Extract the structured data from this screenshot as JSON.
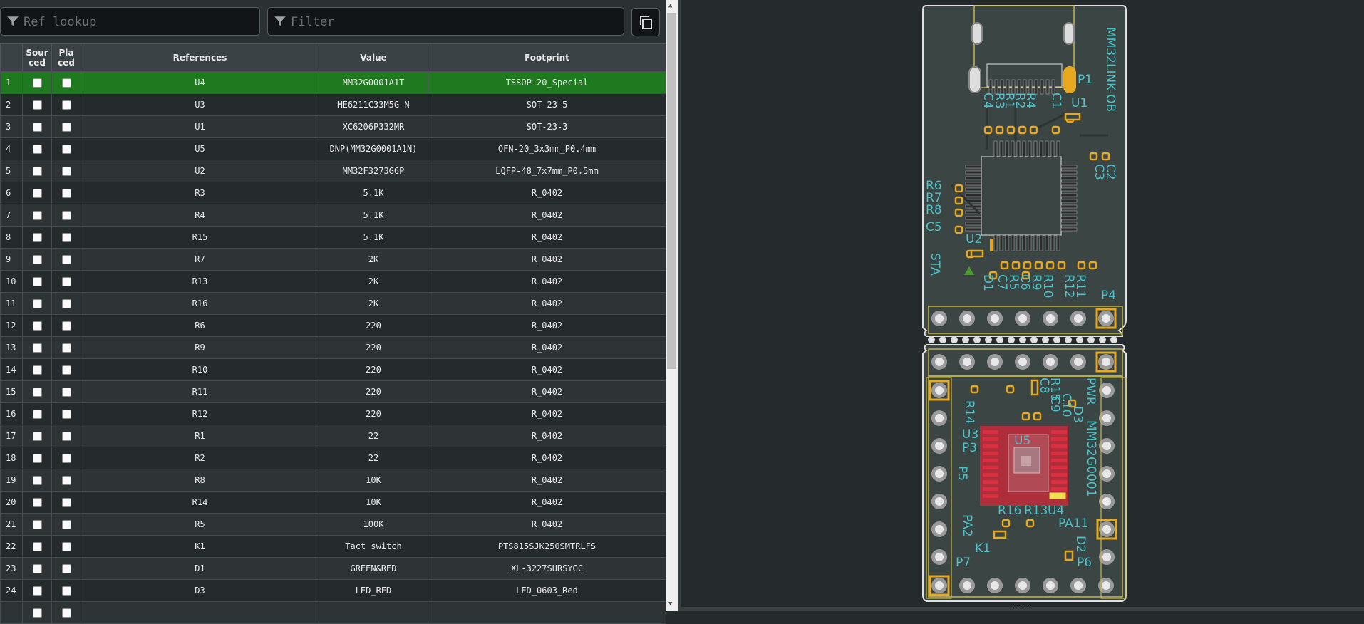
{
  "toolbar": {
    "ref_placeholder": "Ref lookup",
    "filter_placeholder": "Filter"
  },
  "table": {
    "headers": {
      "sourced": "Sourced",
      "placed": "Placed",
      "references": "References",
      "value": "Value",
      "footprint": "Footprint"
    },
    "rows": [
      {
        "n": "1",
        "ref": "U4",
        "value": "MM32G0001A1T",
        "footprint": "TSSOP-20_Special"
      },
      {
        "n": "2",
        "ref": "U3",
        "value": "ME6211C33M5G-N",
        "footprint": "SOT-23-5"
      },
      {
        "n": "3",
        "ref": "U1",
        "value": "XC6206P332MR",
        "footprint": "SOT-23-3"
      },
      {
        "n": "4",
        "ref": "U5",
        "value": "DNP(MM32G0001A1N)",
        "footprint": "QFN-20_3x3mm_P0.4mm"
      },
      {
        "n": "5",
        "ref": "U2",
        "value": "MM32F3273G6P",
        "footprint": "LQFP-48_7x7mm_P0.5mm"
      },
      {
        "n": "6",
        "ref": "R3",
        "value": "5.1K",
        "footprint": "R_0402"
      },
      {
        "n": "7",
        "ref": "R4",
        "value": "5.1K",
        "footprint": "R_0402"
      },
      {
        "n": "8",
        "ref": "R15",
        "value": "5.1K",
        "footprint": "R_0402"
      },
      {
        "n": "9",
        "ref": "R7",
        "value": "2K",
        "footprint": "R_0402"
      },
      {
        "n": "10",
        "ref": "R13",
        "value": "2K",
        "footprint": "R_0402"
      },
      {
        "n": "11",
        "ref": "R16",
        "value": "2K",
        "footprint": "R_0402"
      },
      {
        "n": "12",
        "ref": "R6",
        "value": "220",
        "footprint": "R_0402"
      },
      {
        "n": "13",
        "ref": "R9",
        "value": "220",
        "footprint": "R_0402"
      },
      {
        "n": "14",
        "ref": "R10",
        "value": "220",
        "footprint": "R_0402"
      },
      {
        "n": "15",
        "ref": "R11",
        "value": "220",
        "footprint": "R_0402"
      },
      {
        "n": "16",
        "ref": "R12",
        "value": "220",
        "footprint": "R_0402"
      },
      {
        "n": "17",
        "ref": "R1",
        "value": "22",
        "footprint": "R_0402"
      },
      {
        "n": "18",
        "ref": "R2",
        "value": "22",
        "footprint": "R_0402"
      },
      {
        "n": "19",
        "ref": "R8",
        "value": "10K",
        "footprint": "R_0402"
      },
      {
        "n": "20",
        "ref": "R14",
        "value": "10K",
        "footprint": "R_0402"
      },
      {
        "n": "21",
        "ref": "R5",
        "value": "100K",
        "footprint": "R_0402"
      },
      {
        "n": "22",
        "ref": "K1",
        "value": "Tact switch",
        "footprint": "PTS815SJK250SMTRLFS"
      },
      {
        "n": "23",
        "ref": "D1",
        "value": "GREEN&RED",
        "footprint": "XL-3227SURSYGC"
      },
      {
        "n": "24",
        "ref": "D3",
        "value": "LED_RED",
        "footprint": "LED_0603_Red"
      }
    ]
  },
  "pcb": {
    "labels": {
      "board_name": "MM32LINK-OB",
      "bottom_name": "MM32G0001",
      "pwr": "PWR",
      "sta": "STA",
      "p1": "P1",
      "p3": "P3",
      "p4": "P4",
      "p5": "P5",
      "p6": "P6",
      "p7": "P7",
      "u1": "U1",
      "u2": "U2",
      "u3": "U3",
      "u4": "U4",
      "u5": "U5",
      "c1": "C1",
      "c2": "C2",
      "c3": "C3",
      "c4": "C4",
      "c5": "C5",
      "c6": "C6",
      "c7": "C7",
      "c8": "C8",
      "c9": "C9",
      "c10": "C10",
      "r1": "R1",
      "r2": "R2",
      "r3": "R3",
      "r4": "R4",
      "r5": "R5",
      "r6": "R6",
      "r7": "R7",
      "r8": "R8",
      "r9": "R9",
      "r10": "R10",
      "r11": "R11",
      "r12": "R12",
      "r13": "R13",
      "r14": "R14",
      "r15": "R15",
      "r16": "R16",
      "d1": "D1",
      "d2": "D2",
      "d3": "D3",
      "k1": "K1",
      "pa2": "PA2",
      "pa11": "PA11"
    }
  },
  "colors": {
    "selected_row": "#1f7a1f",
    "silk": "#4ec1c8",
    "pad": "#e8a820",
    "edge": "#e0e0e0",
    "board": "#3a4544",
    "courtyard": "#c8b84a",
    "highlight": "#d02030"
  }
}
